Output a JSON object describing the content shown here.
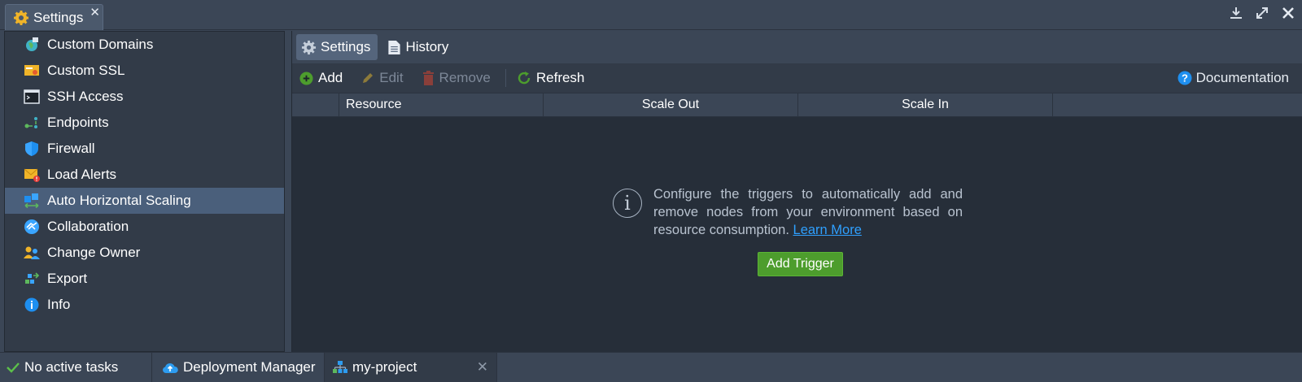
{
  "window": {
    "tab_title": "Settings",
    "close_symbol": "✕"
  },
  "sidebar": {
    "items": [
      {
        "label": "Custom Domains",
        "icon": "globe-icon"
      },
      {
        "label": "Custom SSL",
        "icon": "certificate-icon"
      },
      {
        "label": "SSH Access",
        "icon": "terminal-icon"
      },
      {
        "label": "Endpoints",
        "icon": "endpoints-icon"
      },
      {
        "label": "Firewall",
        "icon": "shield-icon"
      },
      {
        "label": "Load Alerts",
        "icon": "alert-envelope-icon"
      },
      {
        "label": "Auto Horizontal Scaling",
        "icon": "scaling-icon"
      },
      {
        "label": "Collaboration",
        "icon": "handshake-icon"
      },
      {
        "label": "Change Owner",
        "icon": "users-icon"
      },
      {
        "label": "Export",
        "icon": "export-icon"
      },
      {
        "label": "Info",
        "icon": "info-icon"
      }
    ],
    "active_index": 6
  },
  "subtabs": {
    "settings": "Settings",
    "history": "History"
  },
  "toolbar": {
    "add": "Add",
    "edit": "Edit",
    "remove": "Remove",
    "refresh": "Refresh",
    "documentation": "Documentation"
  },
  "grid": {
    "columns": [
      "Resource",
      "Scale Out",
      "Scale In"
    ]
  },
  "empty_state": {
    "message": "Configure the triggers to automatically add and remove nodes from your environment based on resource consumption.",
    "link": "Learn More",
    "button": "Add Trigger",
    "info_glyph": "i"
  },
  "taskbar": {
    "status": "No active tasks",
    "deployment_manager": "Deployment Manager",
    "project": "my-project",
    "close_symbol": "✕"
  },
  "colors": {
    "accent_green": "#4d9d2d",
    "link_blue": "#2fa0ff",
    "active_item": "#4a5f7b"
  }
}
